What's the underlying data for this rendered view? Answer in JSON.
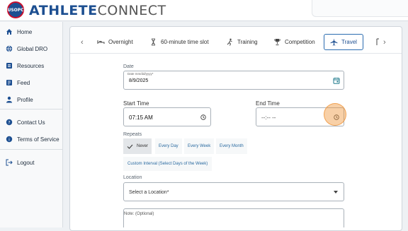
{
  "header": {
    "logo_text": "USOPC",
    "brand_bold": "ATHLETE",
    "brand_light": "CONNECT"
  },
  "sidebar": {
    "items": [
      {
        "label": "Home",
        "icon": "home-icon"
      },
      {
        "label": "Global DRO",
        "icon": "globe-icon"
      },
      {
        "label": "Resources",
        "icon": "list-icon"
      },
      {
        "label": "Feed",
        "icon": "feed-icon"
      },
      {
        "label": "Profile",
        "icon": "person-icon"
      },
      {
        "label": "Contact Us",
        "icon": "help-icon"
      },
      {
        "label": "Terms of Service",
        "icon": "info-icon"
      },
      {
        "label": "Logout",
        "icon": "logout-icon"
      }
    ]
  },
  "tabs": [
    {
      "label": "Overnight",
      "icon": "bed-icon"
    },
    {
      "label": "60-minute time slot",
      "icon": "hourglass-icon"
    },
    {
      "label": "Training",
      "icon": "running-icon"
    },
    {
      "label": "Competition",
      "icon": "trophy-icon"
    },
    {
      "label": "Travel",
      "icon": "plane-icon",
      "active": true
    }
  ],
  "form": {
    "date_label": "Date",
    "date_hint": "Date mm/dd/yyyy*",
    "date_value": "8/9/2025",
    "start_label": "Start Time",
    "start_value": "07:15 AM",
    "end_label": "End Time",
    "end_value": "--:-- --",
    "repeats_label": "Repeats",
    "repeat_options": [
      "Never",
      "Every Day",
      "Every Week",
      "Every Month"
    ],
    "repeat_selected": "Never",
    "custom_option": "Custom Interval (Select Days of the Week)",
    "location_label": "Location",
    "location_placeholder": "Select a Location*",
    "note_label": "Note: (Optional)"
  },
  "colors": {
    "brand_blue": "#1d4f91",
    "link_blue": "#2a6aa0",
    "highlight_orange": "#f0963c"
  }
}
